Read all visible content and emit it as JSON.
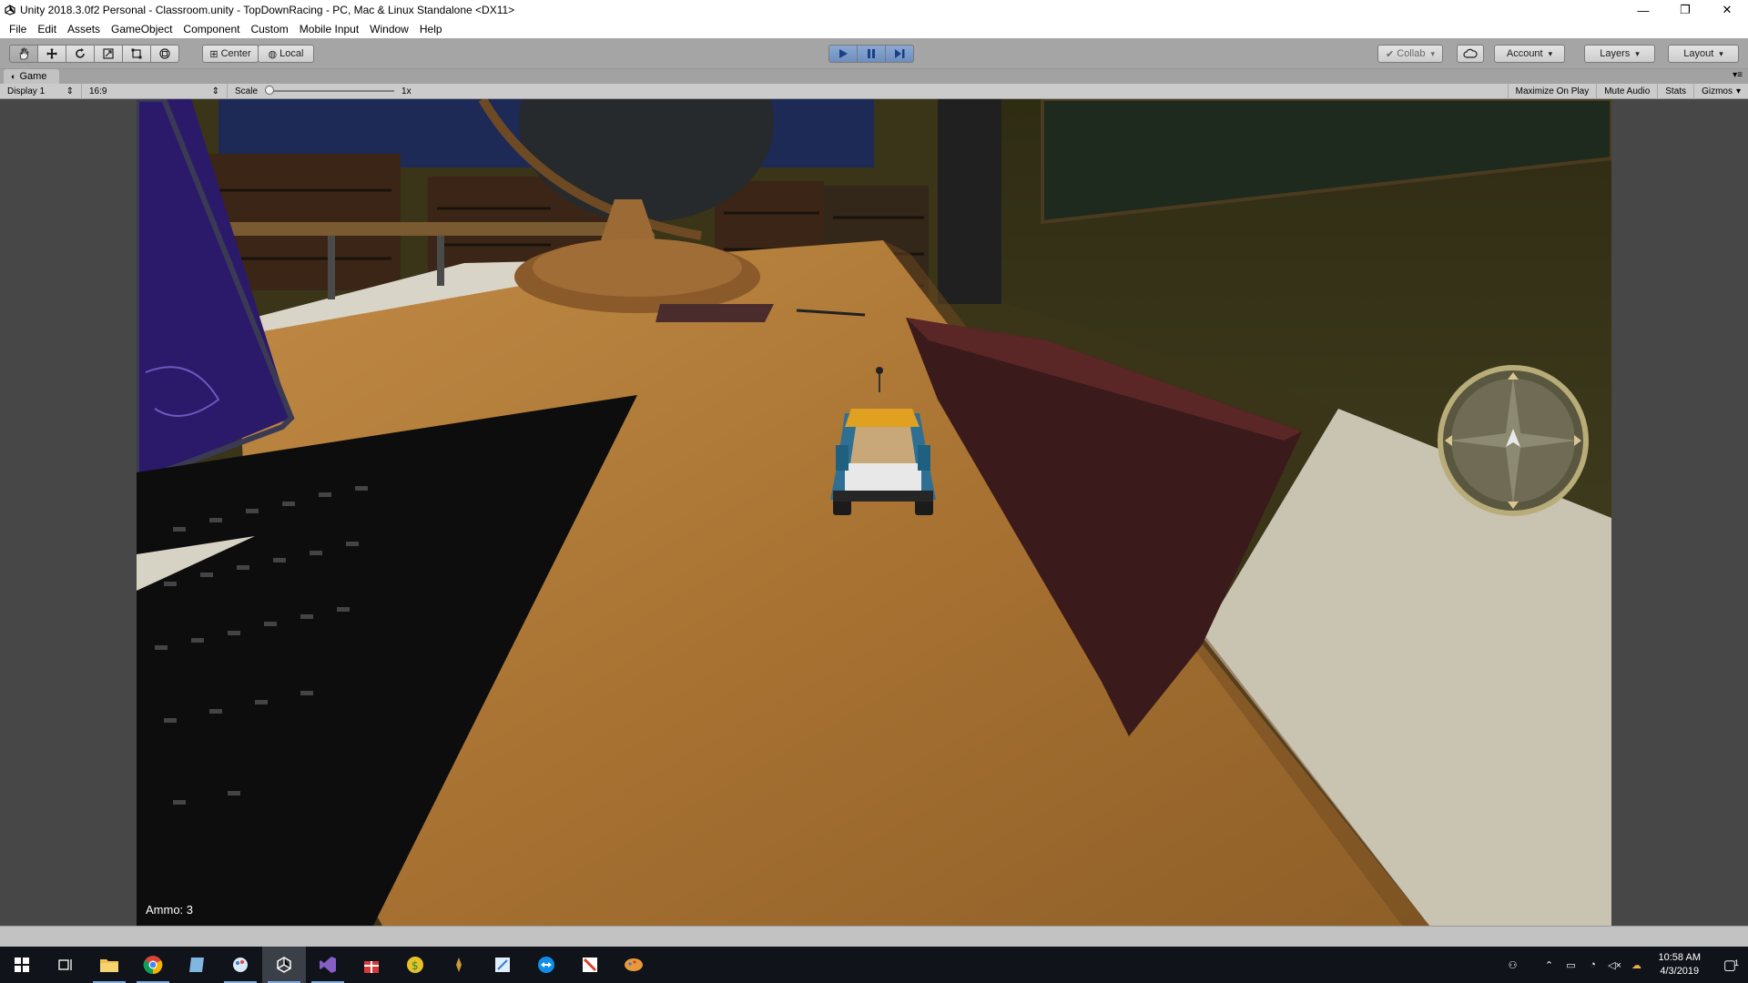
{
  "window": {
    "title": "Unity 2018.3.0f2 Personal - Classroom.unity - TopDownRacing - PC, Mac & Linux Standalone <DX11>",
    "controls": [
      "minimize",
      "restore",
      "close"
    ]
  },
  "menu": [
    "File",
    "Edit",
    "Assets",
    "GameObject",
    "Component",
    "Custom",
    "Mobile Input",
    "Window",
    "Help"
  ],
  "toolbar": {
    "tools": [
      "hand-tool",
      "move-tool",
      "rotate-tool",
      "scale-tool",
      "rect-tool",
      "transform-tool"
    ],
    "pivot_label": "Center",
    "space_label": "Local",
    "collab_label": "Collab",
    "account_label": "Account",
    "layers_label": "Layers",
    "layout_label": "Layout"
  },
  "game_tab": {
    "label": "Game",
    "display": "Display 1",
    "aspect": "16:9",
    "scale_label": "Scale",
    "scale_value": "1x",
    "maximize_label": "Maximize On Play",
    "mute_label": "Mute Audio",
    "stats_label": "Stats",
    "gizmos_label": "Gizmos"
  },
  "hud": {
    "ammo_text": "Ammo: 3"
  },
  "taskbar": {
    "apps": [
      "start",
      "task-view",
      "file-explorer",
      "chrome",
      "notepad",
      "paint",
      "unity",
      "visual-studio",
      "gift-app",
      "coin-app",
      "game-app",
      "editor-app",
      "teamviewer",
      "office-app",
      "palette-app"
    ],
    "time": "10:58 AM",
    "date": "4/3/2019",
    "notification_count": "1"
  },
  "colors": {
    "editor_bg": "#c2c2c2",
    "toolbar_bg": "#a5a5a5",
    "play_active": "#7495c6",
    "taskbar_bg": "#101319",
    "table_wood": "#b07a36"
  }
}
